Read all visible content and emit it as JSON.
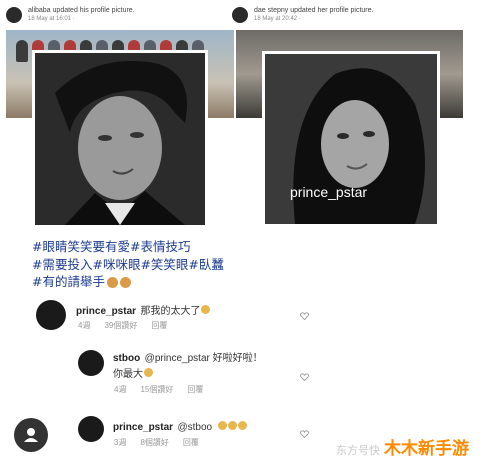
{
  "posts": {
    "left": {
      "username": "alibaba",
      "action": "updated his profile picture.",
      "time": "18 May at 16:01 · ",
      "audience_icon": "globe-icon"
    },
    "right": {
      "username": "dae stepny",
      "action": "updated her profile picture.",
      "time": "18 May at 20:42 · ",
      "audience_icon": "globe-icon"
    }
  },
  "profile_watermark": "prince_pstar",
  "hashtags": [
    "#眼睛笑笑要有愛#表情技巧",
    "#需要投入#咪咪眼#笑笑眼#臥蠶",
    "#有的請舉手"
  ],
  "comments": [
    {
      "name": "prince_pstar",
      "text": "那我的太大了",
      "time": "4週",
      "likes": "39個讚好",
      "reply": "回覆"
    },
    {
      "name": "stboo",
      "text_line1": "@prince_pstar 好啦好啦！",
      "text_line2": "你最大",
      "time": "4週",
      "likes": "15個讚好",
      "reply": "回覆"
    },
    {
      "name": "prince_pstar",
      "text": "@stboo",
      "time": "3週",
      "likes": "8個讚好",
      "reply": "回覆"
    }
  ],
  "watermark": {
    "small": "东方号快",
    "large": "木木新手游"
  },
  "icons": {
    "heart": "heart-icon",
    "emoji": "emoji-icon",
    "avatar": "avatar"
  }
}
